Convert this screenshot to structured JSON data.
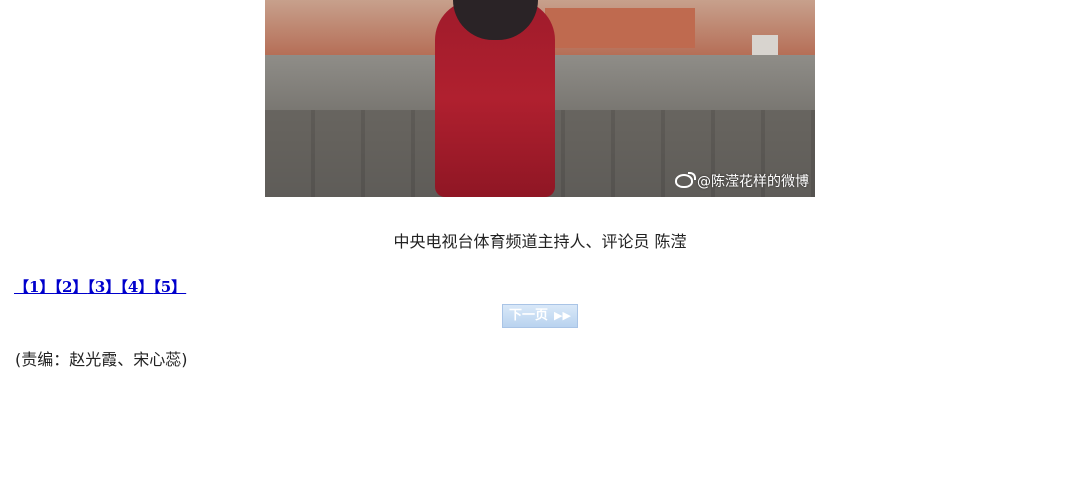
{
  "photo": {
    "watermark_text": "@陈滢花样的微博",
    "watermark_icon": "weibo-icon"
  },
  "caption": "中央电视台体育频道主持人、评论员 陈滢",
  "pager": {
    "pages": [
      "【1】",
      "【2】",
      "【3】",
      "【4】",
      "【5】"
    ]
  },
  "next_button": {
    "label": "下一页",
    "icon": "double-arrow-right-icon",
    "icon_glyph": "▶▶"
  },
  "editor_note": "(责编：赵光霞、宋心蕊)"
}
